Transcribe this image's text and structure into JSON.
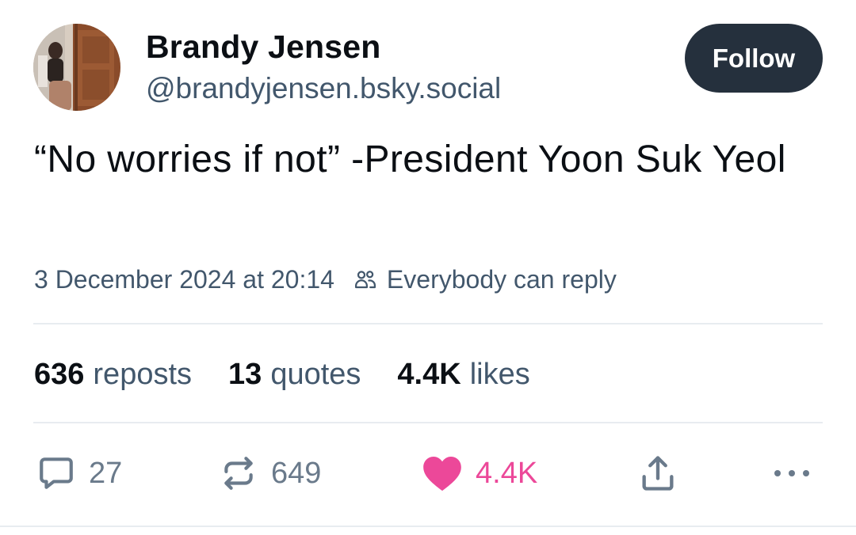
{
  "author": {
    "name": "Brandy Jensen",
    "handle": "@brandyjensen.bsky.social",
    "follow_label": "Follow"
  },
  "post": {
    "text": "“No worries if not” -President Yoon Suk Yeol",
    "timestamp": "3 December 2024 at 20:14",
    "reply_setting": "Everybody can reply"
  },
  "stats": {
    "reposts": {
      "value": "636",
      "label": "reposts"
    },
    "quotes": {
      "value": "13",
      "label": "quotes"
    },
    "likes": {
      "value": "4.4K",
      "label": "likes"
    }
  },
  "actions": {
    "reply_count": "27",
    "repost_count": "649",
    "like_count": "4.4K"
  },
  "colors": {
    "follow_bg": "#25303d",
    "secondary_text": "#42576c",
    "action_icon": "#6a7a8b",
    "like_active": "#ec4899",
    "divider": "#e8ecf0"
  },
  "icons": {
    "reply": "speech-bubble-icon",
    "repost": "repost-arrows-icon",
    "like": "heart-icon",
    "share": "share-upload-icon",
    "more": "ellipsis-icon",
    "reply_setting": "people-icon"
  }
}
